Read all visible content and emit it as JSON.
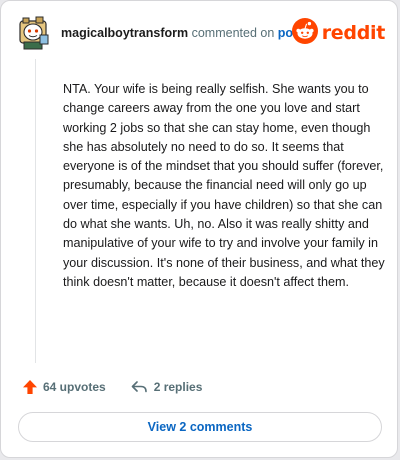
{
  "header": {
    "username": "magicalboytransform",
    "action_text": "commented on",
    "post_link": "post",
    "logo_text": "reddit"
  },
  "comment": {
    "body": "NTA. Your wife is being really selfish. She wants you to change careers away from the one you love and start working 2 jobs so that she can stay home, even though she has absolutely no need to do so. It seems that everyone is of the mindset that you should suffer (forever, presumably, because the financial need will only go up over time, especially if you have children) so that she can do what she wants. Uh, no. Also it was really shitty and manipulative of your wife to try and involve your family in your discussion. It's none of their business, and what they think doesn't matter, because it doesn't affect them."
  },
  "stats": {
    "upvotes": "64 upvotes",
    "replies": "2 replies"
  },
  "footer": {
    "view_comments": "View 2 comments"
  },
  "icons": {
    "avatar": "snoo-avatar",
    "logo": "reddit-logo-icon",
    "upvote": "upvote-arrow-icon",
    "reply": "reply-arrow-icon"
  },
  "colors": {
    "brand": "#ff4500",
    "link": "#0a66c2",
    "upvote": "#ff4500",
    "muted": "#576f76"
  }
}
